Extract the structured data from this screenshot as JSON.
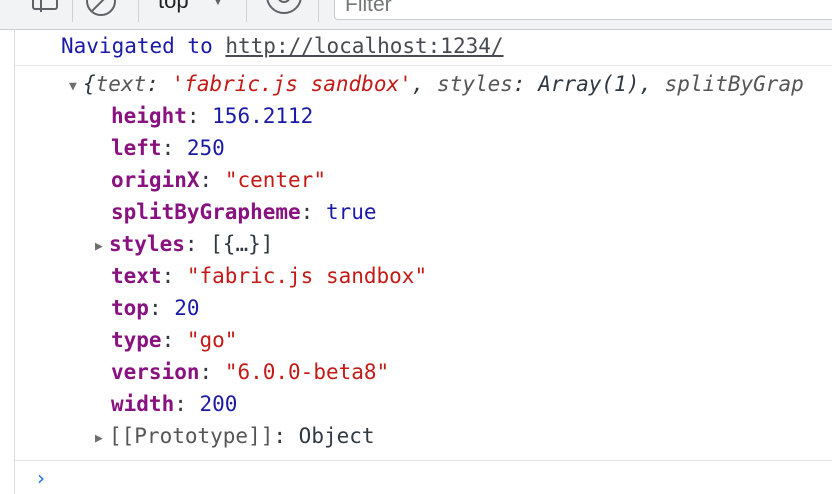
{
  "toolbar": {
    "context": "top",
    "context_arrow": "▼",
    "filter_placeholder": "Filter"
  },
  "navigation": {
    "text": "Navigated to",
    "url": "http://localhost:1234/"
  },
  "object": {
    "expand_arrow": "▼",
    "preview": {
      "open": "{",
      "text_key": "text",
      "text_value": "'fabric.js sandbox'",
      "styles_key": "styles",
      "styles_value": "Array(1)",
      "split_key": "splitByGrap"
    },
    "properties": [
      {
        "key": "height",
        "value": "156.2112",
        "type": "number"
      },
      {
        "key": "left",
        "value": "250",
        "type": "number"
      },
      {
        "key": "originX",
        "value": "\"center\"",
        "type": "string"
      },
      {
        "key": "splitByGrapheme",
        "value": "true",
        "type": "boolean"
      },
      {
        "key": "styles",
        "value": "[{…}]",
        "type": "object"
      },
      {
        "key": "text",
        "value": "\"fabric.js sandbox\"",
        "type": "string"
      },
      {
        "key": "top",
        "value": "20",
        "type": "number"
      },
      {
        "key": "type",
        "value": "\"go\"",
        "type": "string"
      },
      {
        "key": "version",
        "value": "\"6.0.0-beta8\"",
        "type": "string"
      },
      {
        "key": "width",
        "value": "200",
        "type": "number"
      }
    ],
    "prototype": {
      "key": "[[Prototype]]",
      "value": "Object"
    },
    "collapsed_arrow": "▶"
  },
  "prompt": {
    "symbol": "›"
  }
}
